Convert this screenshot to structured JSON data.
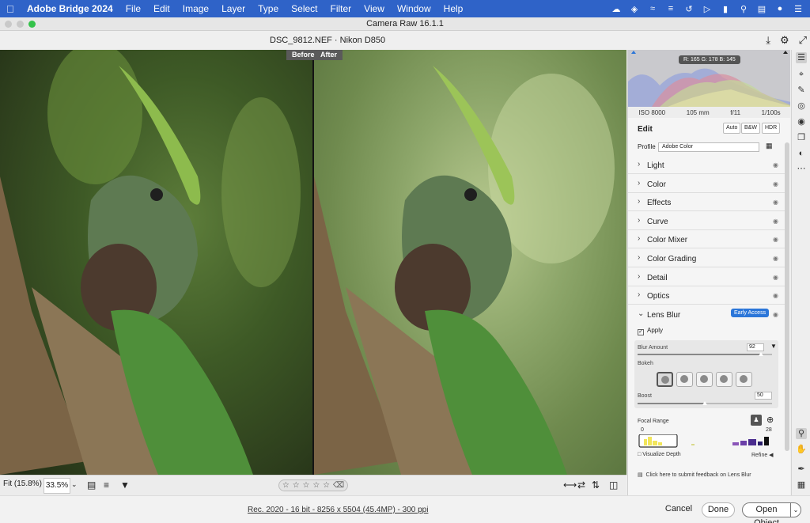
{
  "menubar": {
    "app": "Adobe Bridge 2024",
    "items": [
      "File",
      "Edit",
      "Image",
      "Layer",
      "Type",
      "Select",
      "Filter",
      "View",
      "Window",
      "Help"
    ]
  },
  "window": {
    "title": "Camera Raw 16.1.1"
  },
  "file": {
    "name": "DSC_9812.NEF  ·  Nikon D850"
  },
  "viewer": {
    "before_label": "Before",
    "after_label": "After"
  },
  "viewtools": {
    "fit": "Fit (15.8%)",
    "zoom": "33.5%",
    "stars": [
      "☆",
      "☆",
      "☆",
      "☆",
      "☆"
    ]
  },
  "status": {
    "info": "Rec. 2020 - 16 bit - 8256 x 5504 (45.4MP) - 300 ppi"
  },
  "buttons": {
    "cancel": "Cancel",
    "done": "Done",
    "open": "Open Object"
  },
  "histogram": {
    "rgb_readout": "R: 165   G: 178   B: 145"
  },
  "exif": [
    "ISO 8000",
    "105 mm",
    "f/11",
    "1/100s"
  ],
  "edit": {
    "title": "Edit",
    "auto": "Auto",
    "bw": "B&W",
    "hdr": "HDR",
    "profile_label": "Profile",
    "profile_value": "Adobe Color"
  },
  "sections": [
    "Light",
    "Color",
    "Effects",
    "Curve",
    "Color Mixer",
    "Color Grading",
    "Detail",
    "Optics"
  ],
  "lens_blur": {
    "name": "Lens Blur",
    "badge": "Early Access",
    "apply": "Apply",
    "blur_amount_label": "Blur Amount",
    "blur_amount": "92",
    "blur_amount_level": 0.92,
    "bokeh_label": "Bokeh",
    "boost_label": "Boost",
    "boost": "50",
    "boost_level": 0.5,
    "focal_range_label": "Focal Range",
    "focal_min": "0",
    "focal_max": "28",
    "visualize_depth": "Visualize Depth",
    "refine": "Refine",
    "feedback": "Click here to submit feedback on Lens Blur"
  }
}
